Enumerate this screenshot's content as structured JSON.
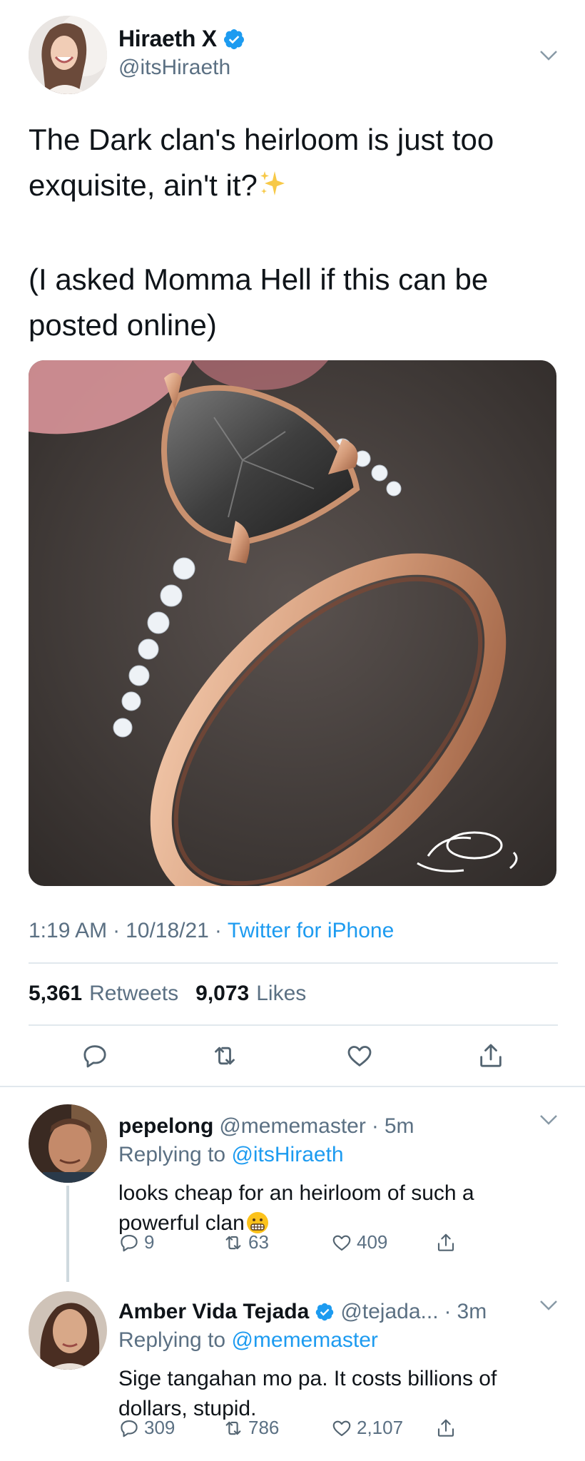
{
  "tweet": {
    "display_name": "Hiraeth X",
    "handle": "@itsHiraeth",
    "text_line1": "The Dark clan's heirloom is just too exquisite, ain't it?",
    "text_line2": "(I asked Momma Hell if this can be posted online)",
    "time": "1:19 AM",
    "date": "10/18/21",
    "source": "Twitter for iPhone",
    "retweets_count": "5,361",
    "retweets_label": "Retweets",
    "likes_count": "9,073",
    "likes_label": "Likes"
  },
  "replies": [
    {
      "display_name": "pepelong",
      "handle": "@mememaster",
      "age": "5m",
      "replying_prefix": "Replying to",
      "replying_to": "@itsHiraeth",
      "text": "looks cheap for an heirloom of such a powerful clan",
      "reply_count": "9",
      "retweet_count": "63",
      "like_count": "409"
    },
    {
      "display_name": "Amber Vida Tejada",
      "handle": "@tejada...",
      "age": "3m",
      "replying_prefix": "Replying to",
      "replying_to": "@mememaster",
      "text": "Sige tangahan mo pa. It costs billions of dollars, stupid.",
      "reply_count": "309",
      "retweet_count": "786",
      "like_count": "2,107"
    }
  ],
  "icons": {
    "verified": "verified-badge-icon",
    "sparkles": "sparkles-emoji",
    "grimace": "grimacing-face-emoji",
    "reply": "reply-icon",
    "retweet": "retweet-icon",
    "like": "heart-icon",
    "share": "share-icon",
    "chevron": "chevron-down-icon"
  },
  "colors": {
    "link": "#1d9bf0",
    "secondary_text": "#5b7083",
    "divider": "#e1e8ed"
  }
}
